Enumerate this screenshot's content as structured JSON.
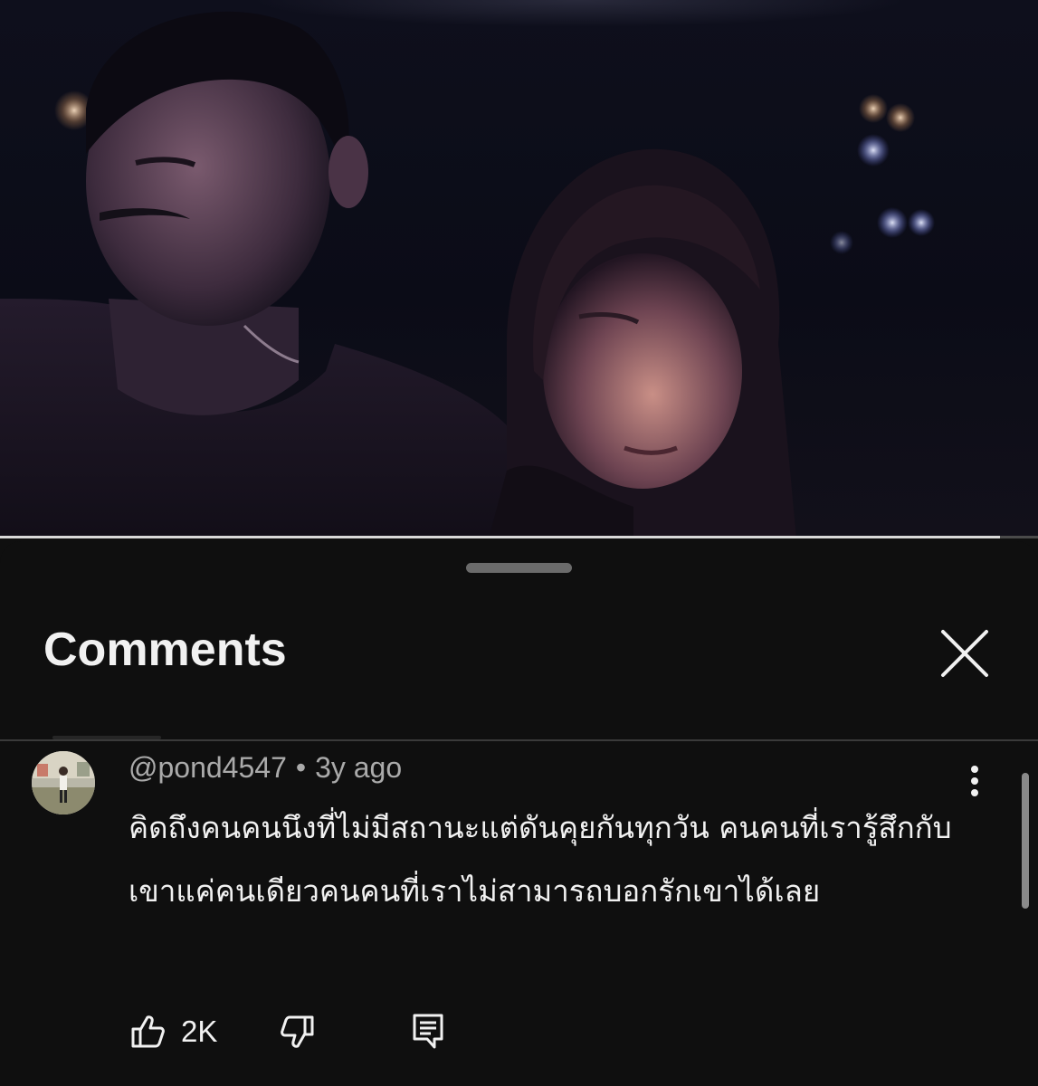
{
  "video": {
    "progress": 0.963
  },
  "comments_panel": {
    "title": "Comments",
    "close_icon": "close-icon"
  },
  "comment": {
    "author": "@pond4547",
    "separator": "•",
    "time": "3y ago",
    "text": "คิดถึงคนคนนึงที่ไม่มีสถานะแต่ดันคุยกันทุกวัน คนคนที่เรารู้สึกกับเขาแค่คนเดียวคนคนที่เราไม่สามารถบอกรักเขาได้เลย",
    "likes": "2K",
    "icons": {
      "more": "more-vert-icon",
      "like": "thumb-up-icon",
      "dislike": "thumb-down-icon",
      "reply": "reply-comment-icon"
    }
  },
  "colors": {
    "background": "#0f0f0f",
    "text_primary": "#f1f1f1",
    "text_secondary": "#aaaaaa"
  }
}
